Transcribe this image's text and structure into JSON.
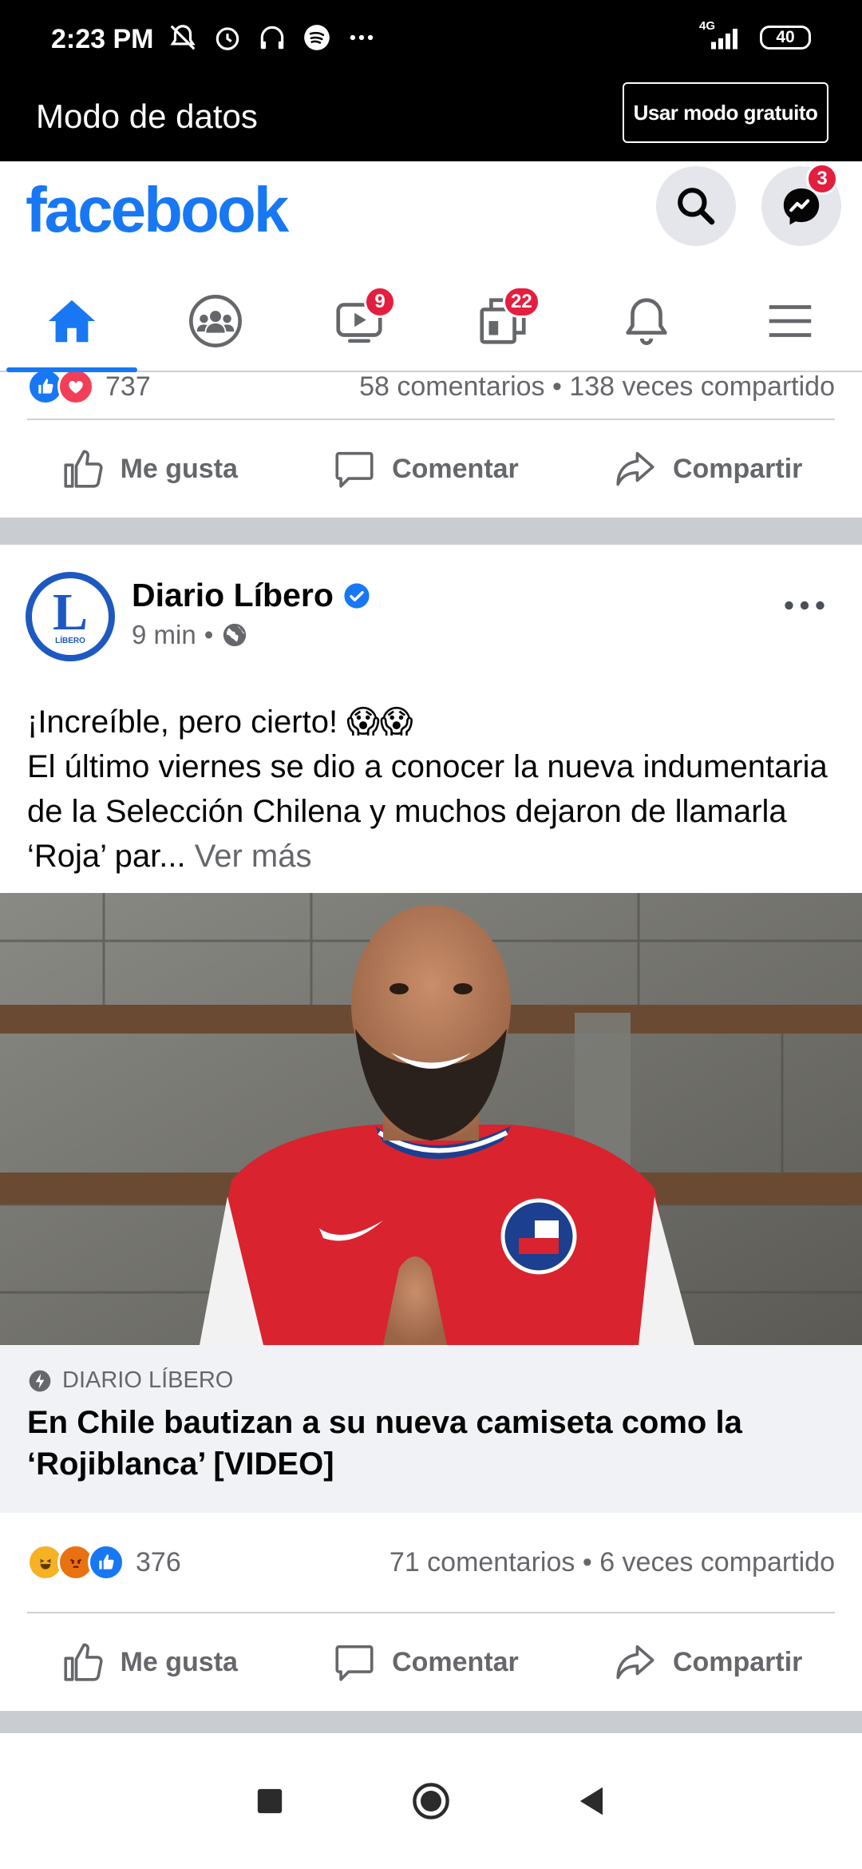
{
  "status_bar": {
    "time": "2:23 PM",
    "network": "4G",
    "battery": "40"
  },
  "data_mode": {
    "title": "Modo de datos",
    "button_label": "Usar modo gratuito"
  },
  "header": {
    "logo": "facebook",
    "messenger_badge": "3"
  },
  "tabs": [
    {
      "name": "home",
      "icon": "home-icon",
      "active": true
    },
    {
      "name": "groups",
      "icon": "groups-icon"
    },
    {
      "name": "watch",
      "icon": "video-icon",
      "badge": "9"
    },
    {
      "name": "pages",
      "icon": "pages-icon",
      "badge": "22"
    },
    {
      "name": "notifications",
      "icon": "bell-icon"
    },
    {
      "name": "menu",
      "icon": "menu-icon"
    }
  ],
  "prev_post": {
    "reaction_count": "737",
    "comments": "58 comentarios",
    "shares": "138 veces compartido"
  },
  "actions": {
    "like": "Me gusta",
    "comment": "Comentar",
    "share": "Compartir"
  },
  "post": {
    "page_name": "Diario Líbero",
    "avatar_letter": "L",
    "avatar_sub": "LÍBERO",
    "time": "9 min",
    "meta_separator": "•",
    "text_line1": "¡Increíble, pero cierto! 😱😱",
    "text_body": "El último viernes se dio a conocer la nueva indumentaria de la Selección Chilena y muchos dejaron de llamarla ‘Roja’ par...",
    "see_more": "Ver más",
    "link_source": "DIARIO LÍBERO",
    "link_title": "En Chile bautizan a su nueva camiseta como la ‘Rojiblanca’ [VIDEO]",
    "reaction_count": "376",
    "comments": "71 comentarios",
    "shares": "6 veces compartido"
  },
  "colors": {
    "brand": "#1877f2",
    "badge": "#e41e3f",
    "secondary_text": "#65676b"
  }
}
